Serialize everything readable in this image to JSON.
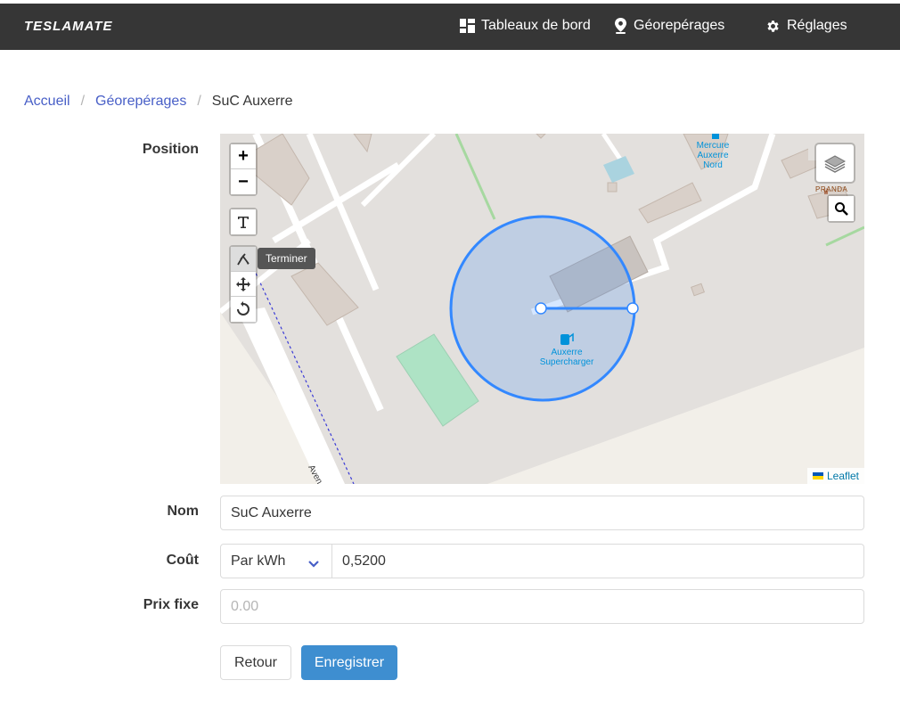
{
  "navbar": {
    "brand": "TESLAMATE",
    "items": [
      {
        "label": "Tableaux de bord",
        "icon": "dashboard-icon"
      },
      {
        "label": "Géorepérages",
        "icon": "map-marker-icon"
      },
      {
        "label": "Réglages",
        "icon": "gear-icon"
      }
    ]
  },
  "breadcrumb": {
    "items": [
      "Accueil",
      "Géorepérages"
    ],
    "current": "SuC Auxerre"
  },
  "form": {
    "position_label": "Position",
    "name_label": "Nom",
    "name_value": "SuC Auxerre",
    "cost_label": "Coût",
    "cost_mode": "Par kWh",
    "cost_value": "0,5200",
    "fixed_label": "Prix fixe",
    "fixed_placeholder": "0.00",
    "back_label": "Retour",
    "save_label": "Enregistrer"
  },
  "map": {
    "zoom_in": "+",
    "zoom_out": "−",
    "tooltip": "Terminer",
    "attribution": "Leaflet",
    "poi_hotel": "Mercure Auxerre Nord",
    "poi_shop": "PRANDA",
    "poi_supercharger": "Auxerre Supercharger",
    "street_label": "Aven",
    "colors": {
      "circle": "#3388ff",
      "road": "#ffffff",
      "building": "#d9d0c9",
      "park": "#aee3c5"
    }
  }
}
